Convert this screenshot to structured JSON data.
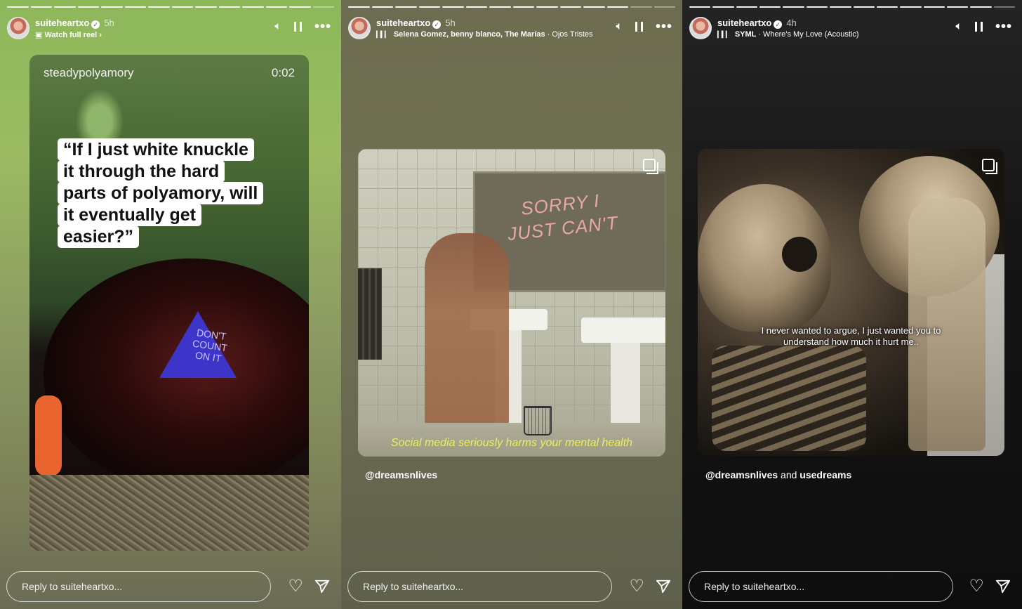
{
  "stories": [
    {
      "progress": {
        "total": 14,
        "done": 13
      },
      "username": "suiteheartxo",
      "time": "5h",
      "subtitle": "Watch full reel",
      "media_user": "steadypolyamory",
      "media_time": "0:02",
      "quote_lines": [
        "“If I just white knuckle",
        "it through the hard",
        "parts of polyamory, will",
        "it eventually get",
        "easier?”"
      ],
      "ball_text": "DON'T COUNT ON IT",
      "reply_placeholder": "Reply to suiteheartxo..."
    },
    {
      "progress": {
        "total": 14,
        "done": 12
      },
      "username": "suiteheartxo",
      "time": "5h",
      "music_artists": "Selena Gomez, benny blanco, The Marías",
      "music_song": "Ojos Tristes",
      "neon_text": "SORRY I JUST CAN'T",
      "caption": "Social media seriously harms your mental health",
      "credit": "@dreamsnlives",
      "reply_placeholder": "Reply to suiteheartxo..."
    },
    {
      "progress": {
        "total": 14,
        "done": 13
      },
      "username": "suiteheartxo",
      "time": "4h",
      "music_artists": "SYML",
      "music_song": "Where's My Love (Acoustic)",
      "caption": "I never wanted to argue, I just wanted you to understand how much it hurt me..",
      "credit_user": "@dreamsnlives",
      "credit_and": "and",
      "credit_user2": "usedreams",
      "reply_placeholder": "Reply to suiteheartxo..."
    }
  ],
  "icons": {
    "volume": "volume-icon",
    "pause": "pause-icon",
    "more": "more-options-icon",
    "heart": "heart-icon",
    "send": "send-icon",
    "verified": "verified-badge-icon",
    "reel": "reel-icon",
    "music": "music-bars-icon",
    "multi": "carousel-icon"
  }
}
